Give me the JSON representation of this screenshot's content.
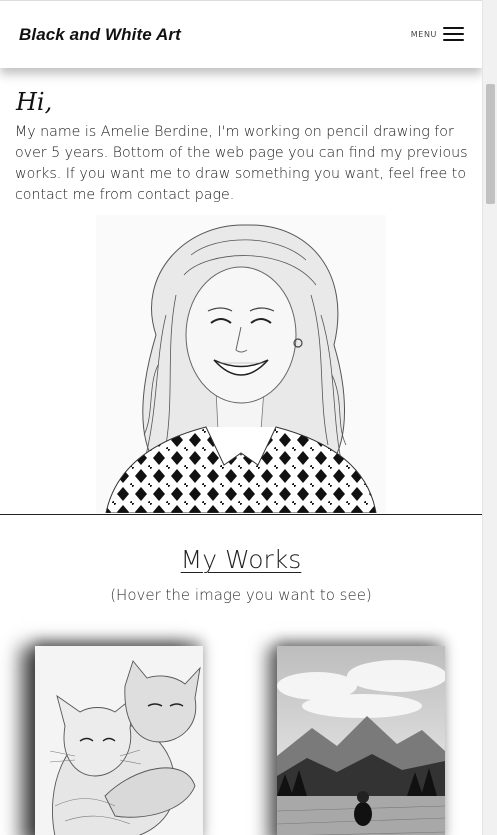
{
  "header": {
    "brand": "Black and White Art",
    "menu_label": "MENU"
  },
  "intro": {
    "greeting": "Hi,",
    "text": "My name is Amelie Berdine, I'm working on pencil drawing for over 5 years. Bottom of the web page you can find my previous works. If you want me to draw something you want, feel free to contact me from contact page."
  },
  "works": {
    "title": "My Works",
    "subtitle": "(Hover the image you want to see)"
  },
  "colors": {
    "background": "#ffffff",
    "text": "#222222",
    "header_shadow": "#000000",
    "divider": "#222222"
  },
  "icons": {
    "menu": "hamburger-icon"
  }
}
